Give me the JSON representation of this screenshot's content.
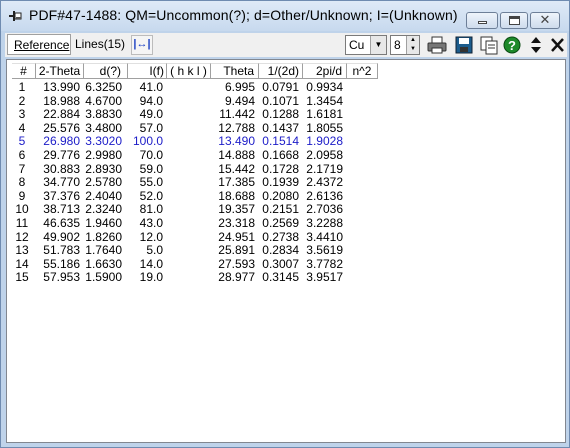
{
  "window": {
    "title": "PDF#47-1488: QM=Uncommon(?); d=Other/Unknown; I=(Unknown)"
  },
  "toolbar": {
    "tab_reference": "Reference",
    "tab_lines": "Lines(15)",
    "radiation": "Cu",
    "count": "8",
    "icons": [
      "expand-columns-icon",
      "print-icon",
      "save-icon",
      "copy-icon",
      "help-icon",
      "up-down-icon",
      "close-icon"
    ]
  },
  "table": {
    "columns": [
      "#",
      "2-Theta",
      "d(?)",
      "I(f)",
      "( h k l )",
      "Theta",
      "1/(2d)",
      "2pi/d",
      "n^2"
    ],
    "selected_row": 5,
    "selected_color": "#1c1cc8",
    "rows": [
      [
        "1",
        "13.990",
        "6.3250",
        "41.0",
        "",
        "6.995",
        "0.0791",
        "0.9934",
        ""
      ],
      [
        "2",
        "18.988",
        "4.6700",
        "94.0",
        "",
        "9.494",
        "0.1071",
        "1.3454",
        ""
      ],
      [
        "3",
        "22.884",
        "3.8830",
        "49.0",
        "",
        "11.442",
        "0.1288",
        "1.6181",
        ""
      ],
      [
        "4",
        "25.576",
        "3.4800",
        "57.0",
        "",
        "12.788",
        "0.1437",
        "1.8055",
        ""
      ],
      [
        "5",
        "26.980",
        "3.3020",
        "100.0",
        "",
        "13.490",
        "0.1514",
        "1.9028",
        ""
      ],
      [
        "6",
        "29.776",
        "2.9980",
        "70.0",
        "",
        "14.888",
        "0.1668",
        "2.0958",
        ""
      ],
      [
        "7",
        "30.883",
        "2.8930",
        "59.0",
        "",
        "15.442",
        "0.1728",
        "2.1719",
        ""
      ],
      [
        "8",
        "34.770",
        "2.5780",
        "55.0",
        "",
        "17.385",
        "0.1939",
        "2.4372",
        ""
      ],
      [
        "9",
        "37.376",
        "2.4040",
        "52.0",
        "",
        "18.688",
        "0.2080",
        "2.6136",
        ""
      ],
      [
        "10",
        "38.713",
        "2.3240",
        "81.0",
        "",
        "19.357",
        "0.2151",
        "2.7036",
        ""
      ],
      [
        "11",
        "46.635",
        "1.9460",
        "43.0",
        "",
        "23.318",
        "0.2569",
        "3.2288",
        ""
      ],
      [
        "12",
        "49.902",
        "1.8260",
        "12.0",
        "",
        "24.951",
        "0.2738",
        "3.4410",
        ""
      ],
      [
        "13",
        "51.783",
        "1.7640",
        "5.0",
        "",
        "25.891",
        "0.2834",
        "3.5619",
        ""
      ],
      [
        "14",
        "55.186",
        "1.6630",
        "14.0",
        "",
        "27.593",
        "0.3007",
        "3.7782",
        ""
      ],
      [
        "15",
        "57.953",
        "1.5900",
        "19.0",
        "",
        "28.977",
        "0.3145",
        "3.9517",
        ""
      ]
    ]
  }
}
